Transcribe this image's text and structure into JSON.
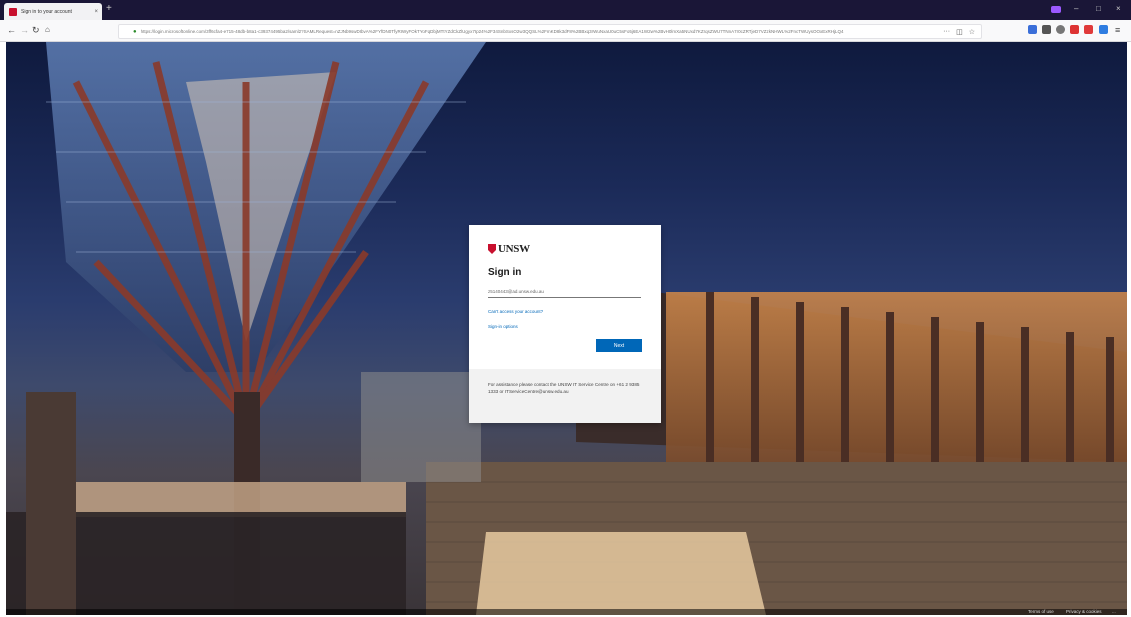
{
  "browser": {
    "tab_title": "Sign in to your account",
    "tab_close": "×",
    "new_tab": "+",
    "url": "https://login.microsoftonline.com/3ff6cfa4-e715-48db-b8a1-c39374495ba2/saml2?SAMLRequest=nZJNb9swDIbvA%2FYfDN0TfyRIWyFOkTYoFqDbjMTtYZdCkZlUgyx7Ip24%2F34SnbSxsO2w3QQSL%2FmKD8k3dF8%2BBxq3rWuNxaU0uC5sFo5j6EA1W2w%2BvH0lmXa5NUxd7KZrqsZWU7TNnA7r0cZRTjeD7VZzkNHWL%2FncTWUysOOxExRHjLQ4",
    "win_minimize": "–",
    "win_maximize": "□",
    "win_close": "×",
    "colors": {
      "titlebar": "#1a1637",
      "toolbar": "#f9f9fa"
    }
  },
  "signin": {
    "logo_text": "UNSW",
    "heading": "Sign in",
    "email_value": "z5140443@ad.unsw.edu.au",
    "cant_access_link": "Can't access your account?",
    "sign_in_options_link": "Sign-in options",
    "next_button": "Next",
    "help_text": "For assistance please contact the UNSW IT Service Centre on +61 2 9385 1333 or ITServiceCentre@unsw.edu.au",
    "colors": {
      "accent": "#0067b8",
      "brand_red": "#c8102e",
      "help_bg": "#f2f2f2"
    }
  },
  "footer": {
    "terms": "Terms of use",
    "privacy": "Privacy & cookies",
    "more": "..."
  }
}
